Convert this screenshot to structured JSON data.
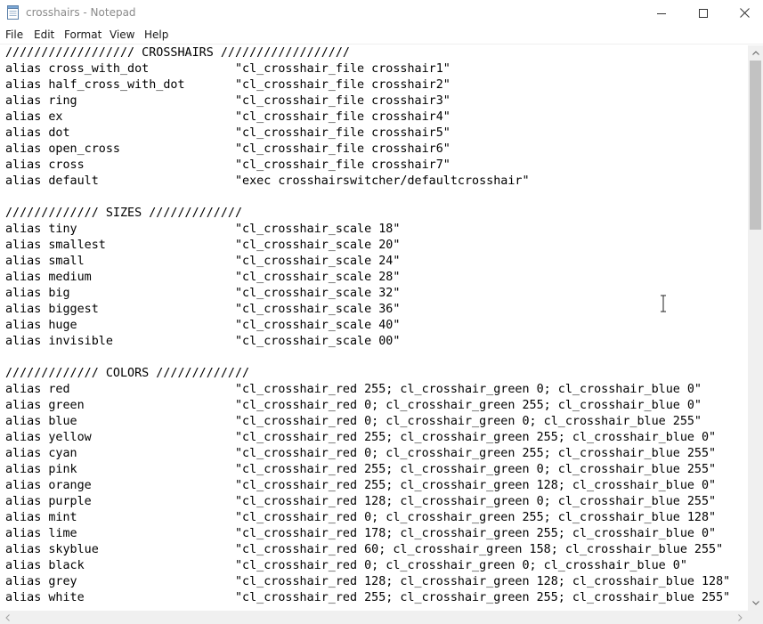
{
  "window": {
    "title": "crosshairs - Notepad",
    "icon": "notepad-icon",
    "controls": [
      "minimize-icon",
      "maximize-icon",
      "close-icon"
    ]
  },
  "menu": {
    "items": [
      "File",
      "Edit",
      "Format",
      "View",
      "Help"
    ]
  },
  "editor": {
    "lines": [
      "////////////////// CROSSHAIRS //////////////////",
      "alias cross_with_dot            \"cl_crosshair_file crosshair1\"",
      "alias half_cross_with_dot       \"cl_crosshair_file crosshair2\"",
      "alias ring                      \"cl_crosshair_file crosshair3\"",
      "alias ex                        \"cl_crosshair_file crosshair4\"",
      "alias dot                       \"cl_crosshair_file crosshair5\"",
      "alias open_cross                \"cl_crosshair_file crosshair6\"",
      "alias cross                     \"cl_crosshair_file crosshair7\"",
      "alias default                   \"exec crosshairswitcher/defaultcrosshair\"",
      "",
      "///////////// SIZES /////////////",
      "alias tiny                      \"cl_crosshair_scale 18\"",
      "alias smallest                  \"cl_crosshair_scale 20\"",
      "alias small                     \"cl_crosshair_scale 24\"",
      "alias medium                    \"cl_crosshair_scale 28\"",
      "alias big                       \"cl_crosshair_scale 32\"",
      "alias biggest                   \"cl_crosshair_scale 36\"",
      "alias huge                      \"cl_crosshair_scale 40\"",
      "alias invisible                 \"cl_crosshair_scale 00\"",
      "",
      "///////////// COLORS /////////////",
      "alias red                       \"cl_crosshair_red 255; cl_crosshair_green 0; cl_crosshair_blue 0\"",
      "alias green                     \"cl_crosshair_red 0; cl_crosshair_green 255; cl_crosshair_blue 0\"",
      "alias blue                      \"cl_crosshair_red 0; cl_crosshair_green 0; cl_crosshair_blue 255\"",
      "alias yellow                    \"cl_crosshair_red 255; cl_crosshair_green 255; cl_crosshair_blue 0\"",
      "alias cyan                      \"cl_crosshair_red 0; cl_crosshair_green 255; cl_crosshair_blue 255\"",
      "alias pink                      \"cl_crosshair_red 255; cl_crosshair_green 0; cl_crosshair_blue 255\"",
      "alias orange                    \"cl_crosshair_red 255; cl_crosshair_green 128; cl_crosshair_blue 0\"",
      "alias purple                    \"cl_crosshair_red 128; cl_crosshair_green 0; cl_crosshair_blue 255\"",
      "alias mint                      \"cl_crosshair_red 0; cl_crosshair_green 255; cl_crosshair_blue 128\"",
      "alias lime                      \"cl_crosshair_red 178; cl_crosshair_green 255; cl_crosshair_blue 0\"",
      "alias skyblue                   \"cl_crosshair_red 60; cl_crosshair_green 158; cl_crosshair_blue 255\"",
      "alias black                     \"cl_crosshair_red 0; cl_crosshair_green 0; cl_crosshair_blue 0\"",
      "alias grey                      \"cl_crosshair_red 128; cl_crosshair_green 128; cl_crosshair_blue 128\"",
      "alias white                     \"cl_crosshair_red 255; cl_crosshair_green 255; cl_crosshair_blue 255\""
    ]
  },
  "colors": {
    "title_text": "#8a8a8a",
    "menu_text": "#1a1a1a",
    "editor_text": "#000000",
    "scrollbar_track": "#f0f0f0",
    "scrollbar_thumb": "#c2c2c2"
  }
}
